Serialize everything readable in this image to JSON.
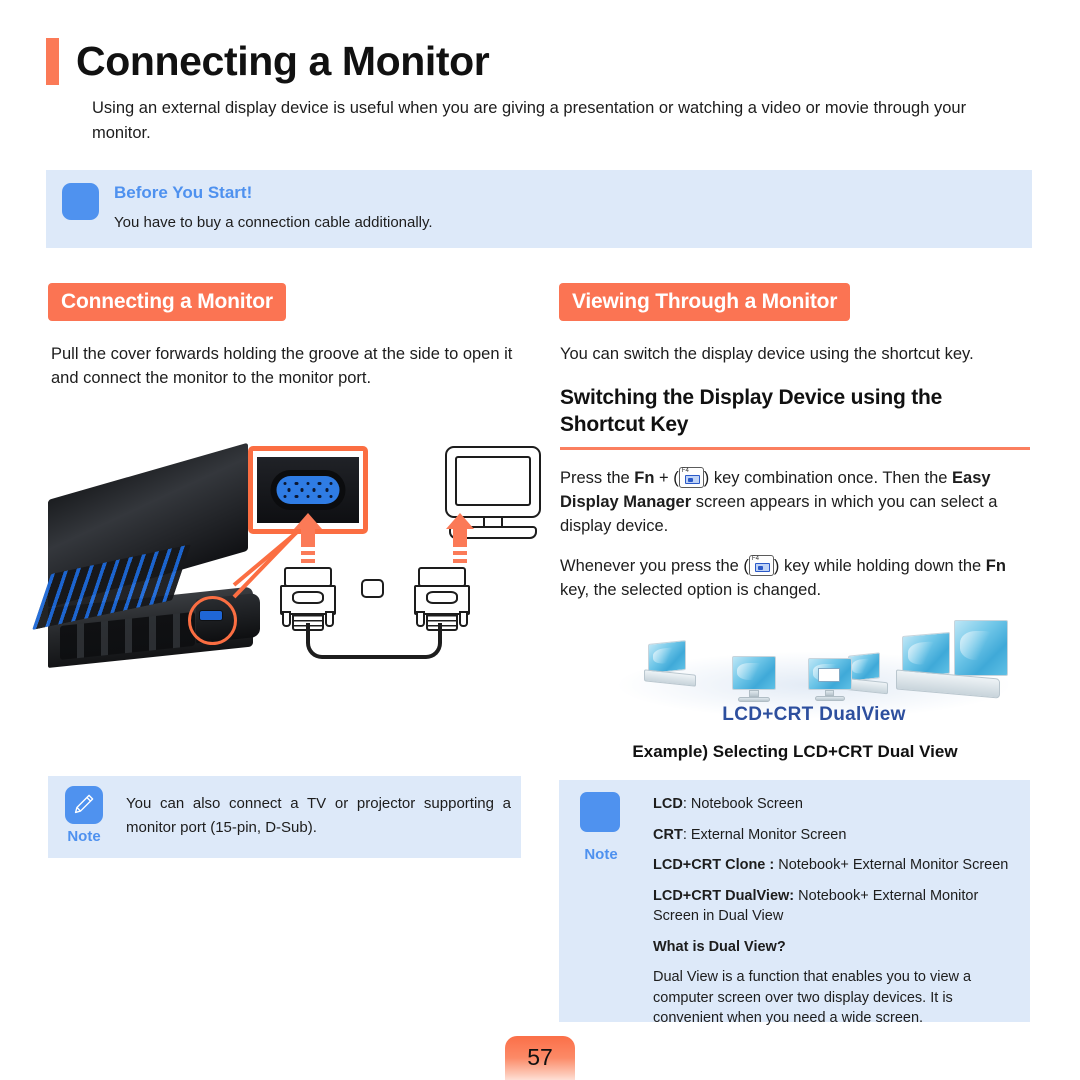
{
  "title": "Connecting a Monitor",
  "intro": "Using an external display device is useful when you are giving a presentation or watching a video or movie through your monitor.",
  "before_you_start": {
    "heading": "Before You Start!",
    "body": "You have to buy a connection cable additionally."
  },
  "left_column": {
    "section_header": "Connecting a Monitor",
    "paragraph": "Pull the cover forwards holding the groove at the side to open it and connect the monitor to the monitor port.",
    "note": {
      "label": "Note",
      "text": "You can also connect a TV or projector supporting a monitor port (15-pin, D-Sub)."
    }
  },
  "right_column": {
    "section_header": "Viewing Through a Monitor",
    "intro": "You can switch the display device using the shortcut key.",
    "sub_heading": "Switching the Display Device using the Shortcut Key",
    "para1_a": "Press the ",
    "para1_fn": "Fn",
    "para1_b": " + (",
    "para1_c": ") key combination once. Then the ",
    "para1_bold": "Easy Display Manager",
    "para1_d": " screen appears in which you can select a display device.",
    "para2_a": "Whenever you press the (",
    "para2_b": ") key while holding down the ",
    "para2_fn": "Fn",
    "para2_c": " key, the selected option is changed.",
    "key_glyph_label": "F4",
    "illustration_label": "LCD+CRT DualView",
    "example_caption": "Example) Selecting LCD+CRT Dual View",
    "note": {
      "label": "Note",
      "items": [
        {
          "bold": "LCD",
          "rest": ": Notebook Screen"
        },
        {
          "bold": "CRT",
          "rest": ": External Monitor Screen"
        },
        {
          "bold": "LCD+CRT Clone :",
          "rest": " Notebook+ External Monitor Screen"
        },
        {
          "bold": "LCD+CRT DualView:",
          "rest": " Notebook+ External Monitor Screen in Dual View"
        }
      ],
      "question": "What is Dual View?",
      "answer": "Dual View is a function that enables you to view a computer screen over two display devices. It is convenient when you need a wide screen."
    }
  },
  "footer": {
    "page_number": "57"
  },
  "colors": {
    "accent_orange": "#fb7453",
    "accent_blue": "#4f92ef",
    "note_background": "#dde9f9",
    "dualview_label": "#2d4f9e"
  },
  "icons": {
    "note_icon": "pencil-icon",
    "monitor_icon": "monitor-icon",
    "vga_port_icon": "vga-port-icon"
  }
}
